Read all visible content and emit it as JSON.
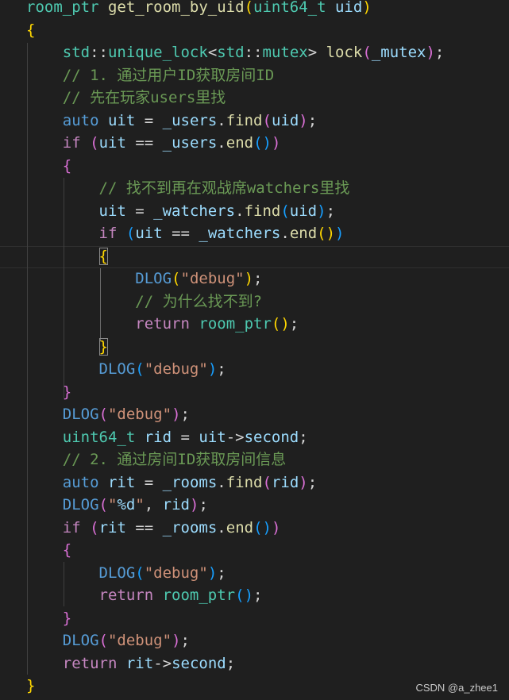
{
  "colors": {
    "background": "#1f1f1f",
    "keyword": "#c586c0",
    "type": "#4ec9b0",
    "function": "#dcdcaa",
    "variable": "#9cdcfe",
    "string": "#ce9178",
    "comment": "#6a9955",
    "macro": "#569cd6",
    "bracket_level_1": "#ffd700",
    "bracket_level_2": "#da70d6",
    "bracket_level_3": "#179fff"
  },
  "code": {
    "lines": [
      [
        [
          "type",
          "room_ptr"
        ],
        [
          "plain",
          " "
        ],
        [
          "fn",
          "get_room_by_uid"
        ],
        [
          "b1",
          "("
        ],
        [
          "type",
          "uint64_t"
        ],
        [
          "plain",
          " "
        ],
        [
          "var",
          "uid"
        ],
        [
          "b1",
          ")"
        ]
      ],
      [
        [
          "b1",
          "{"
        ]
      ],
      [
        [
          "plain",
          "    "
        ],
        [
          "type",
          "std"
        ],
        [
          "plain",
          "::"
        ],
        [
          "type",
          "unique_lock"
        ],
        [
          "plain",
          "<"
        ],
        [
          "type",
          "std"
        ],
        [
          "plain",
          "::"
        ],
        [
          "type",
          "mutex"
        ],
        [
          "plain",
          "> "
        ],
        [
          "fn",
          "lock"
        ],
        [
          "b2",
          "("
        ],
        [
          "var",
          "_mutex"
        ],
        [
          "b2",
          ")"
        ],
        [
          "plain",
          ";"
        ]
      ],
      [
        [
          "plain",
          "    "
        ],
        [
          "com",
          "// 1. 通过用户ID获取房间ID"
        ]
      ],
      [
        [
          "plain",
          "    "
        ],
        [
          "com",
          "// 先在玩家users里找"
        ]
      ],
      [
        [
          "plain",
          "    "
        ],
        [
          "macro",
          "auto"
        ],
        [
          "plain",
          " "
        ],
        [
          "var",
          "uit"
        ],
        [
          "plain",
          " = "
        ],
        [
          "var",
          "_users"
        ],
        [
          "plain",
          "."
        ],
        [
          "fn",
          "find"
        ],
        [
          "b2",
          "("
        ],
        [
          "var",
          "uid"
        ],
        [
          "b2",
          ")"
        ],
        [
          "plain",
          ";"
        ]
      ],
      [
        [
          "plain",
          "    "
        ],
        [
          "kw",
          "if"
        ],
        [
          "plain",
          " "
        ],
        [
          "b2",
          "("
        ],
        [
          "var",
          "uit"
        ],
        [
          "plain",
          " == "
        ],
        [
          "var",
          "_users"
        ],
        [
          "plain",
          "."
        ],
        [
          "fn",
          "end"
        ],
        [
          "b3",
          "()"
        ],
        [
          "b2",
          ")"
        ]
      ],
      [
        [
          "plain",
          "    "
        ],
        [
          "b2",
          "{"
        ]
      ],
      [
        [
          "plain",
          "        "
        ],
        [
          "com",
          "// 找不到再在观战席watchers里找"
        ]
      ],
      [
        [
          "plain",
          "        "
        ],
        [
          "var",
          "uit"
        ],
        [
          "plain",
          " = "
        ],
        [
          "var",
          "_watchers"
        ],
        [
          "plain",
          "."
        ],
        [
          "fn",
          "find"
        ],
        [
          "b3",
          "("
        ],
        [
          "var",
          "uid"
        ],
        [
          "b3",
          ")"
        ],
        [
          "plain",
          ";"
        ]
      ],
      [
        [
          "plain",
          "        "
        ],
        [
          "kw",
          "if"
        ],
        [
          "plain",
          " "
        ],
        [
          "b3",
          "("
        ],
        [
          "var",
          "uit"
        ],
        [
          "plain",
          " == "
        ],
        [
          "var",
          "_watchers"
        ],
        [
          "plain",
          "."
        ],
        [
          "fn",
          "end"
        ],
        [
          "b1",
          "()"
        ],
        [
          "b3",
          ")"
        ]
      ],
      [
        [
          "plain",
          "        "
        ],
        [
          "b3m",
          "{"
        ]
      ],
      [
        [
          "plain",
          "            "
        ],
        [
          "macro",
          "DLOG"
        ],
        [
          "b1",
          "("
        ],
        [
          "str",
          "\"debug\""
        ],
        [
          "b1",
          ")"
        ],
        [
          "plain",
          ";"
        ]
      ],
      [
        [
          "plain",
          "            "
        ],
        [
          "com",
          "// 为什么找不到?"
        ]
      ],
      [
        [
          "plain",
          "            "
        ],
        [
          "kw",
          "return"
        ],
        [
          "plain",
          " "
        ],
        [
          "type",
          "room_ptr"
        ],
        [
          "b1",
          "()"
        ],
        [
          "plain",
          ";"
        ]
      ],
      [
        [
          "plain",
          "        "
        ],
        [
          "b3m",
          "}"
        ]
      ],
      [
        [
          "plain",
          "        "
        ],
        [
          "macro",
          "DLOG"
        ],
        [
          "b3",
          "("
        ],
        [
          "str",
          "\"debug\""
        ],
        [
          "b3",
          ")"
        ],
        [
          "plain",
          ";"
        ]
      ],
      [
        [
          "plain",
          "    "
        ],
        [
          "b2",
          "}"
        ]
      ],
      [
        [
          "plain",
          "    "
        ],
        [
          "macro",
          "DLOG"
        ],
        [
          "b2",
          "("
        ],
        [
          "str",
          "\"debug\""
        ],
        [
          "b2",
          ")"
        ],
        [
          "plain",
          ";"
        ]
      ],
      [
        [
          "plain",
          "    "
        ],
        [
          "type",
          "uint64_t"
        ],
        [
          "plain",
          " "
        ],
        [
          "var",
          "rid"
        ],
        [
          "plain",
          " = "
        ],
        [
          "var",
          "uit"
        ],
        [
          "plain",
          "->"
        ],
        [
          "var",
          "second"
        ],
        [
          "plain",
          ";"
        ]
      ],
      [
        [
          "plain",
          "    "
        ],
        [
          "com",
          "// 2. 通过房间ID获取房间信息"
        ]
      ],
      [
        [
          "plain",
          "    "
        ],
        [
          "macro",
          "auto"
        ],
        [
          "plain",
          " "
        ],
        [
          "var",
          "rit"
        ],
        [
          "plain",
          " = "
        ],
        [
          "var",
          "_rooms"
        ],
        [
          "plain",
          "."
        ],
        [
          "fn",
          "find"
        ],
        [
          "b2",
          "("
        ],
        [
          "var",
          "rid"
        ],
        [
          "b2",
          ")"
        ],
        [
          "plain",
          ";"
        ]
      ],
      [
        [
          "plain",
          "    "
        ],
        [
          "macro",
          "DLOG"
        ],
        [
          "b2",
          "("
        ],
        [
          "str",
          "\""
        ],
        [
          "fmt",
          "%d"
        ],
        [
          "str",
          "\""
        ],
        [
          "plain",
          ", "
        ],
        [
          "var",
          "rid"
        ],
        [
          "b2",
          ")"
        ],
        [
          "plain",
          ";"
        ]
      ],
      [
        [
          "plain",
          "    "
        ],
        [
          "kw",
          "if"
        ],
        [
          "plain",
          " "
        ],
        [
          "b2",
          "("
        ],
        [
          "var",
          "rit"
        ],
        [
          "plain",
          " == "
        ],
        [
          "var",
          "_rooms"
        ],
        [
          "plain",
          "."
        ],
        [
          "fn",
          "end"
        ],
        [
          "b3",
          "()"
        ],
        [
          "b2",
          ")"
        ]
      ],
      [
        [
          "plain",
          "    "
        ],
        [
          "b2",
          "{"
        ]
      ],
      [
        [
          "plain",
          "        "
        ],
        [
          "macro",
          "DLOG"
        ],
        [
          "b3",
          "("
        ],
        [
          "str",
          "\"debug\""
        ],
        [
          "b3",
          ")"
        ],
        [
          "plain",
          ";"
        ]
      ],
      [
        [
          "plain",
          "        "
        ],
        [
          "kw",
          "return"
        ],
        [
          "plain",
          " "
        ],
        [
          "type",
          "room_ptr"
        ],
        [
          "b3",
          "()"
        ],
        [
          "plain",
          ";"
        ]
      ],
      [
        [
          "plain",
          "    "
        ],
        [
          "b2",
          "}"
        ]
      ],
      [
        [
          "plain",
          "    "
        ],
        [
          "macro",
          "DLOG"
        ],
        [
          "b2",
          "("
        ],
        [
          "str",
          "\"debug\""
        ],
        [
          "b2",
          ")"
        ],
        [
          "plain",
          ";"
        ]
      ],
      [
        [
          "plain",
          "    "
        ],
        [
          "kw",
          "return"
        ],
        [
          "plain",
          " "
        ],
        [
          "var",
          "rit"
        ],
        [
          "plain",
          "->"
        ],
        [
          "var",
          "second"
        ],
        [
          "plain",
          ";"
        ]
      ],
      [
        [
          "b1",
          "}"
        ]
      ]
    ]
  },
  "watermark": {
    "text": "CSDN @a_zhee1"
  }
}
